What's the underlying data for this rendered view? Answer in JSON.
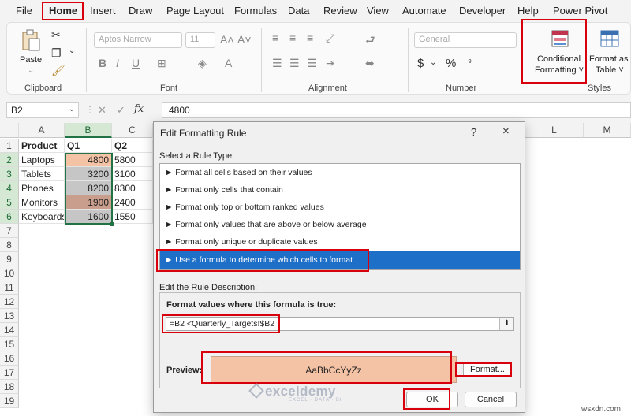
{
  "menu": {
    "tabs": [
      "File",
      "Home",
      "Insert",
      "Draw",
      "Page Layout",
      "Formulas",
      "Data",
      "Review",
      "View",
      "Automate",
      "Developer",
      "Help",
      "Power Pivot"
    ]
  },
  "ribbon": {
    "clipboard": {
      "paste_label": "Paste",
      "group_label": "Clipboard"
    },
    "font": {
      "font_name": "Aptos Narrow",
      "font_size": "11",
      "group_label": "Font"
    },
    "alignment": {
      "group_label": "Alignment"
    },
    "number": {
      "format": "General",
      "group_label": "Number"
    },
    "styles": {
      "conditional_line1": "Conditional",
      "conditional_line2": "Formatting ˅",
      "format_as_line1": "Format as",
      "format_as_line2": "Table ˅",
      "group_label": "Styles"
    }
  },
  "formula_bar": {
    "name_box": "B2",
    "fx": "fx",
    "value": "4800"
  },
  "sheet": {
    "columns": [
      "A",
      "B",
      "C",
      "L",
      "M"
    ],
    "rows": [
      "1",
      "2",
      "3",
      "4",
      "5",
      "6",
      "7",
      "8",
      "9",
      "10",
      "11",
      "12",
      "13",
      "14",
      "15",
      "16",
      "17",
      "18",
      "19"
    ],
    "header": {
      "a": "Product",
      "b": "Q1",
      "c": "Q2"
    },
    "data": [
      {
        "product": "Laptops",
        "q1": "4800",
        "q2": "5800"
      },
      {
        "product": "Tablets",
        "q1": "3200",
        "q2": "3100"
      },
      {
        "product": "Phones",
        "q1": "8200",
        "q2": "8300"
      },
      {
        "product": "Monitors",
        "q1": "1900",
        "q2": "2400"
      },
      {
        "product": "Keyboards",
        "q1": "1600",
        "q2": "1550"
      }
    ],
    "q1_fill_colors": [
      "#f4c2a4",
      "#c6c6c6",
      "#c6c6c6",
      "#c99e8c",
      "#c6c6c6"
    ]
  },
  "dialog": {
    "title": "Edit Formatting Rule",
    "help": "?",
    "close": "×",
    "select_rule_label": "Select a Rule Type:",
    "rule_types": [
      "► Format all cells based on their values",
      "► Format only cells that contain",
      "► Format only top or bottom ranked values",
      "► Format only values that are above or below average",
      "► Format only unique or duplicate values",
      "► Use a formula to determine which cells to format"
    ],
    "edit_desc_label": "Edit the Rule Description:",
    "formula_label": "Format values where this formula is true:",
    "formula_value": "=B2 <Quarterly_Targets!$B2",
    "preview_label": "Preview:",
    "preview_text": "AaBbCcYyZz",
    "format_button": "Format...",
    "ok_button": "OK",
    "cancel_button": "Cancel"
  },
  "watermark": {
    "name": "exceldemy",
    "tagline": "EXCEL · DATA · BI"
  },
  "site_credit": "wsxdn.com"
}
